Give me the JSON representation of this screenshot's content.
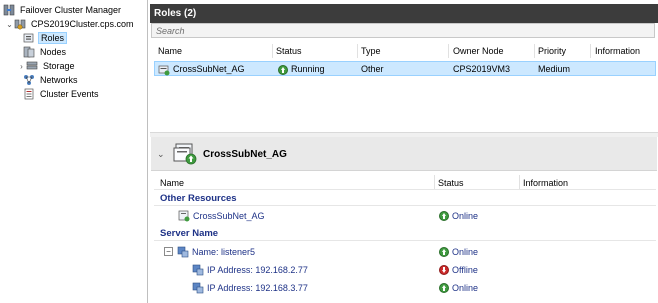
{
  "tree": {
    "root": "Failover Cluster Manager",
    "cluster": "CPS2019Cluster.cps.com",
    "items": [
      {
        "label": "Roles",
        "selected": true
      },
      {
        "label": "Nodes"
      },
      {
        "label": "Storage",
        "expandable": true
      },
      {
        "label": "Networks"
      },
      {
        "label": "Cluster Events"
      }
    ]
  },
  "roles_panel": {
    "title": "Roles (2)",
    "search_placeholder": "Search",
    "columns": [
      "Name",
      "Status",
      "Type",
      "Owner Node",
      "Priority",
      "Information"
    ],
    "rows": [
      {
        "name": "CrossSubNet_AG",
        "status": "Running",
        "type": "Other",
        "owner": "CPS2019VM3",
        "priority": "Medium",
        "information": ""
      }
    ]
  },
  "detail": {
    "title": "CrossSubNet_AG",
    "columns": [
      "Name",
      "Status",
      "Information"
    ],
    "groups": [
      {
        "label": "Other Resources",
        "items": [
          {
            "name": "CrossSubNet_AG",
            "status": "Online"
          }
        ]
      },
      {
        "label": "Server Name",
        "items": [
          {
            "name": "Name: listener5",
            "status": "Online"
          },
          {
            "name": "IP Address: 192.168.2.77",
            "status": "Offline"
          },
          {
            "name": "IP Address: 192.168.3.77",
            "status": "Online"
          }
        ]
      }
    ]
  },
  "colors": {
    "online": "#3f9b3f",
    "offline": "#cc2a2a",
    "selection": "#cce8ff",
    "header_dark": "#3c3c3c",
    "link_blue": "#1e3287"
  }
}
